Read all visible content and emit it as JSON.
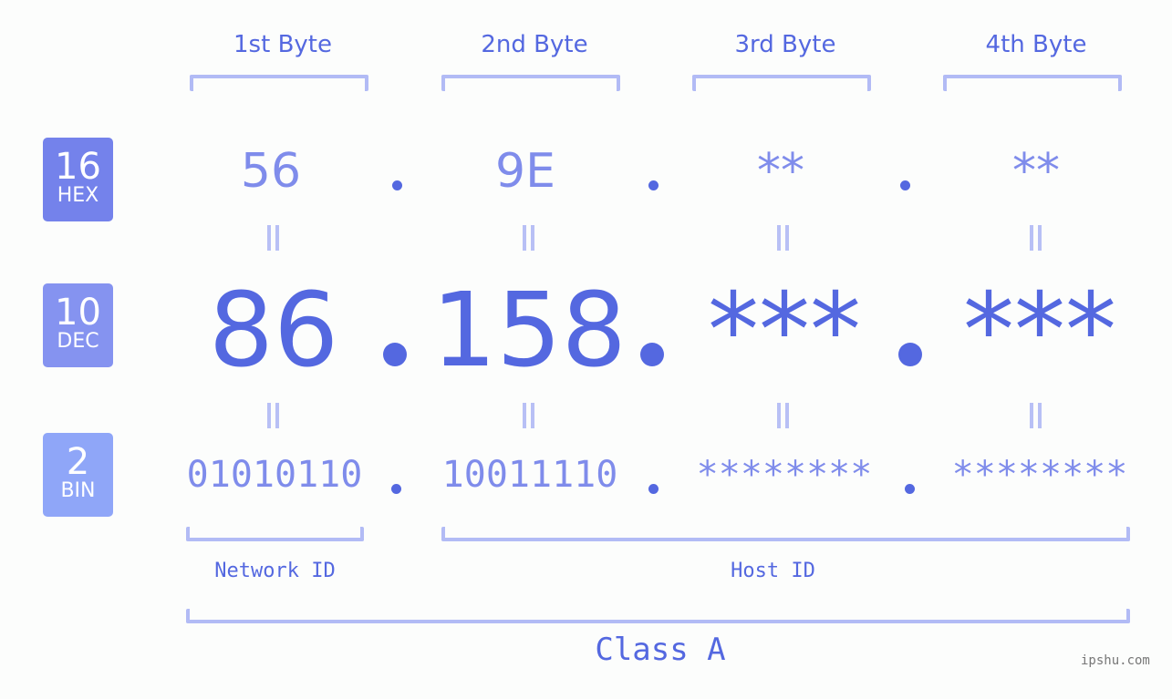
{
  "byte_headers": [
    "1st Byte",
    "2nd Byte",
    "3rd Byte",
    "4th Byte"
  ],
  "badges": {
    "hex": {
      "number": "16",
      "label": "HEX",
      "color": "#7482eb"
    },
    "dec": {
      "number": "10",
      "label": "DEC",
      "color": "#8593f0"
    },
    "bin": {
      "number": "2",
      "label": "BIN",
      "color": "#8fa6f8"
    }
  },
  "hex_values": [
    "56",
    "9E",
    "**",
    "**"
  ],
  "dec_values": [
    "86",
    "158",
    "***",
    "***"
  ],
  "bin_values": [
    "01010110",
    "10011110",
    "********",
    "********"
  ],
  "separator": ".",
  "labels": {
    "network_id": "Network ID",
    "host_id": "Host ID",
    "class": "Class A"
  },
  "watermark": "ipshu.com",
  "colors": {
    "accent": "#5468e0",
    "bracket": "#b2bbf5",
    "light_text": "#7f8ceb"
  }
}
